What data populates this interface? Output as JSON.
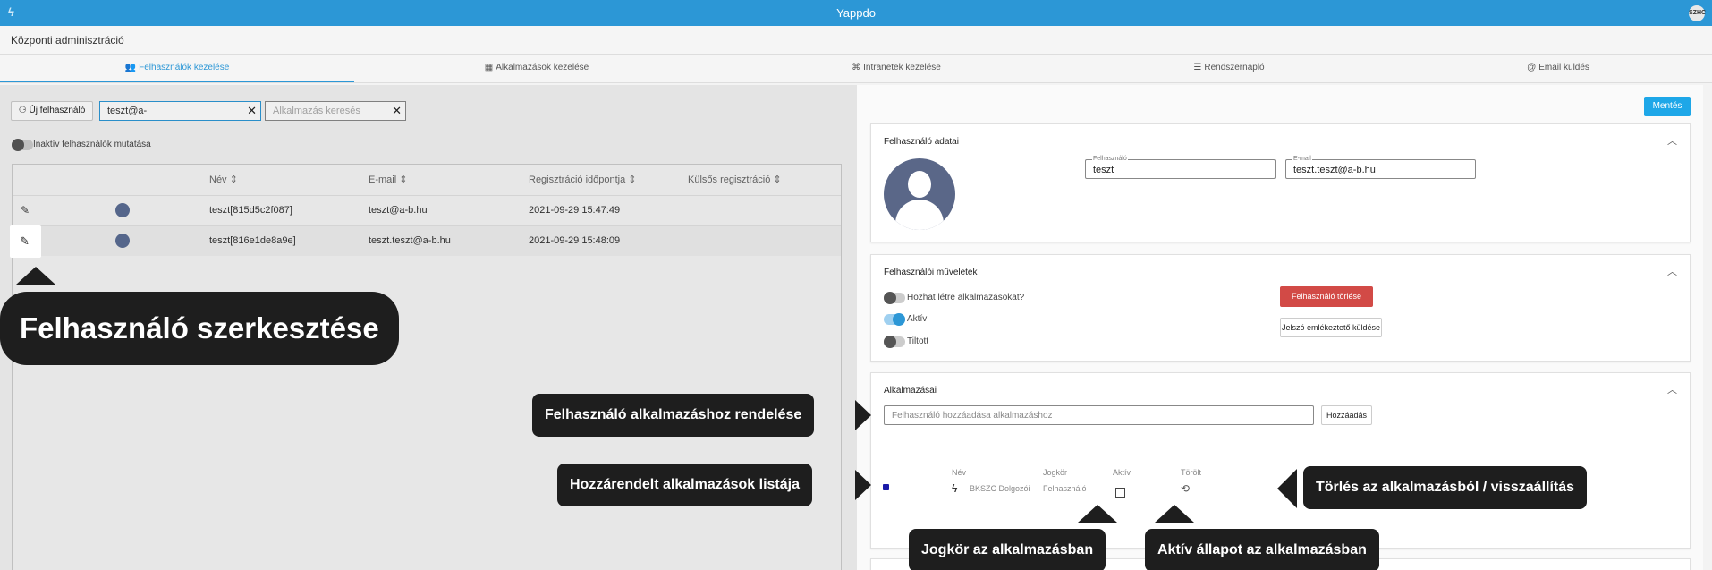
{
  "topbar": {
    "title": "Yappdo",
    "avatar": "SZHC"
  },
  "header": {
    "title": "Központi adminisztráció"
  },
  "tabs": [
    {
      "label": "Felhasználók kezelése",
      "icon": "users-icon"
    },
    {
      "label": "Alkalmazások kezelése",
      "icon": "apps-icon"
    },
    {
      "label": "Intranetek kezelése",
      "icon": "network-icon"
    },
    {
      "label": "Rendszernapló",
      "icon": "list-icon"
    },
    {
      "label": "Email küldés",
      "icon": "at-icon"
    }
  ],
  "left": {
    "new_user_label": "Új felhasználó",
    "search_value": "teszt@a-",
    "app_search_placeholder": "Alkalmazás keresés",
    "inactive_toggle_label": "Inaktív felhasználók mutatása",
    "table": {
      "headers": [
        "Név ⇕",
        "E-mail ⇕",
        "Regisztráció időpontja ⇕",
        "Külsős regisztráció ⇕"
      ],
      "rows": [
        {
          "name": "teszt[815d5c2f087]",
          "email": "teszt@a-b.hu",
          "registered": "2021-09-29 15:47:49",
          "external": ""
        },
        {
          "name": "teszt[816e1de8a9e]",
          "email": "teszt.teszt@a-b.hu",
          "registered": "2021-09-29 15:48:09",
          "external": ""
        }
      ]
    }
  },
  "right": {
    "save_label": "Mentés",
    "user_data": {
      "title": "Felhasználó adatai",
      "username_legend": "Felhasználó",
      "username_value": "teszt",
      "email_legend": "E-mail",
      "email_value": "teszt.teszt@a-b.hu"
    },
    "user_ops": {
      "title": "Felhasználói műveletek",
      "toggles": [
        {
          "label": "Hozhat létre alkalmazásokat?",
          "on": false
        },
        {
          "label": "Aktív",
          "on": true
        },
        {
          "label": "Tiltott",
          "on": false
        }
      ],
      "delete_label": "Felhasználó törlése",
      "reminder_label": "Jelszó emlékeztető küldése"
    },
    "apps": {
      "title": "Alkalmazásai",
      "add_placeholder": "Felhasználó hozzáadása alkalmazáshoz",
      "add_button": "Hozzáadás",
      "columns": [
        "Név",
        "Jogkör",
        "Aktív",
        "Törölt"
      ],
      "rows": [
        {
          "name": "BKSZC Dolgozói",
          "role": "Felhasználó",
          "active": false
        }
      ]
    }
  },
  "callouts": {
    "edit_user": "Felhasználó szerkesztése",
    "assign_app": "Felhasználó alkalmazáshoz rendelése",
    "assigned_list": "Hozzárendelt alkalmazások listája",
    "delete_restore": "Törlés az alkalmazásból / visszaállítás",
    "role": "Jogkör az alkalmazásban",
    "active_state": "Aktív állapot az alkalmazásban"
  },
  "colors": {
    "accent": "#2c97d6",
    "danger": "#d24a46",
    "callout": "#1e1e1e"
  }
}
